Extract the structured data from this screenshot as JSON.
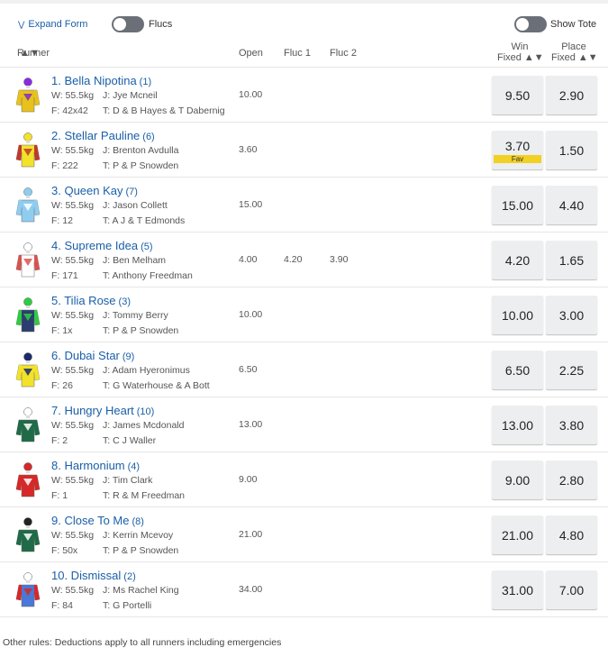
{
  "toolbar": {
    "expand_label": "Expand Form",
    "flucs_label": "Flucs",
    "show_tote_label": "Show Tote"
  },
  "header": {
    "runner": "Runner",
    "open": "Open",
    "fluc1": "Fluc 1",
    "fluc2": "Fluc 2",
    "win_line1": "Win",
    "win_line2": "Fixed",
    "place_line1": "Place",
    "place_line2": "Fixed"
  },
  "runners": [
    {
      "name": "1. Bella Nipotina",
      "barrier": "(1)",
      "weight": "W: 55.5kg",
      "jockey": "J: Jye Mcneil",
      "form": "F: 42x42",
      "trainer": "T: D & B Hayes & T Dabernig",
      "open": "10.00",
      "fluc1": "",
      "fluc2": "",
      "win": "9.50",
      "place": "2.90",
      "fav": ""
    },
    {
      "name": "2. Stellar Pauline",
      "barrier": "(6)",
      "weight": "W: 55.5kg",
      "jockey": "J: Brenton Avdulla",
      "form": "F: 222",
      "trainer": "T: P & P Snowden",
      "open": "3.60",
      "fluc1": "",
      "fluc2": "",
      "win": "3.70",
      "place": "1.50",
      "fav": "Fav"
    },
    {
      "name": "3. Queen Kay",
      "barrier": "(7)",
      "weight": "W: 55.5kg",
      "jockey": "J: Jason Collett",
      "form": "F: 12",
      "trainer": "T: A J & T Edmonds",
      "open": "15.00",
      "fluc1": "",
      "fluc2": "",
      "win": "15.00",
      "place": "4.40",
      "fav": ""
    },
    {
      "name": "4. Supreme Idea",
      "barrier": "(5)",
      "weight": "W: 55.5kg",
      "jockey": "J: Ben Melham",
      "form": "F: 171",
      "trainer": "T: Anthony Freedman",
      "open": "4.00",
      "fluc1": "4.20",
      "fluc2": "3.90",
      "win": "4.20",
      "place": "1.65",
      "fav": ""
    },
    {
      "name": "5. Tilia Rose",
      "barrier": "(3)",
      "weight": "W: 55.5kg",
      "jockey": "J: Tommy Berry",
      "form": "F: 1x",
      "trainer": "T: P & P Snowden",
      "open": "10.00",
      "fluc1": "",
      "fluc2": "",
      "win": "10.00",
      "place": "3.00",
      "fav": ""
    },
    {
      "name": "6. Dubai Star",
      "barrier": "(9)",
      "weight": "W: 55.5kg",
      "jockey": "J: Adam Hyeronimus",
      "form": "F: 26",
      "trainer": "T: G Waterhouse & A Bott",
      "open": "6.50",
      "fluc1": "",
      "fluc2": "",
      "win": "6.50",
      "place": "2.25",
      "fav": ""
    },
    {
      "name": "7. Hungry Heart",
      "barrier": "(10)",
      "weight": "W: 55.5kg",
      "jockey": "J: James Mcdonald",
      "form": "F: 2",
      "trainer": "T: C J Waller",
      "open": "13.00",
      "fluc1": "",
      "fluc2": "",
      "win": "13.00",
      "place": "3.80",
      "fav": ""
    },
    {
      "name": "8. Harmonium",
      "barrier": "(4)",
      "weight": "W: 55.5kg",
      "jockey": "J: Tim Clark",
      "form": "F: 1",
      "trainer": "T: R & M Freedman",
      "open": "9.00",
      "fluc1": "",
      "fluc2": "",
      "win": "9.00",
      "place": "2.80",
      "fav": ""
    },
    {
      "name": "9. Close To Me",
      "barrier": "(8)",
      "weight": "W: 55.5kg",
      "jockey": "J: Kerrin Mcevoy",
      "form": "F: 50x",
      "trainer": "T: P & P Snowden",
      "open": "21.00",
      "fluc1": "",
      "fluc2": "",
      "win": "21.00",
      "place": "4.80",
      "fav": ""
    },
    {
      "name": "10. Dismissal",
      "barrier": "(2)",
      "weight": "W: 55.5kg",
      "jockey": "J: Ms Rachel King",
      "form": "F: 84",
      "trainer": "T: G Portelli",
      "open": "34.00",
      "fluc1": "",
      "fluc2": "",
      "win": "31.00",
      "place": "7.00",
      "fav": ""
    }
  ],
  "footer": {
    "rules_label": "Other rules:",
    "rules_text": "Deductions apply to all runners including emergencies"
  },
  "colors": {
    "link": "#1a5fa8",
    "button_bg": "#eceeef",
    "fav_badge": "#f2d024",
    "toggle_off": "#6b7078"
  }
}
